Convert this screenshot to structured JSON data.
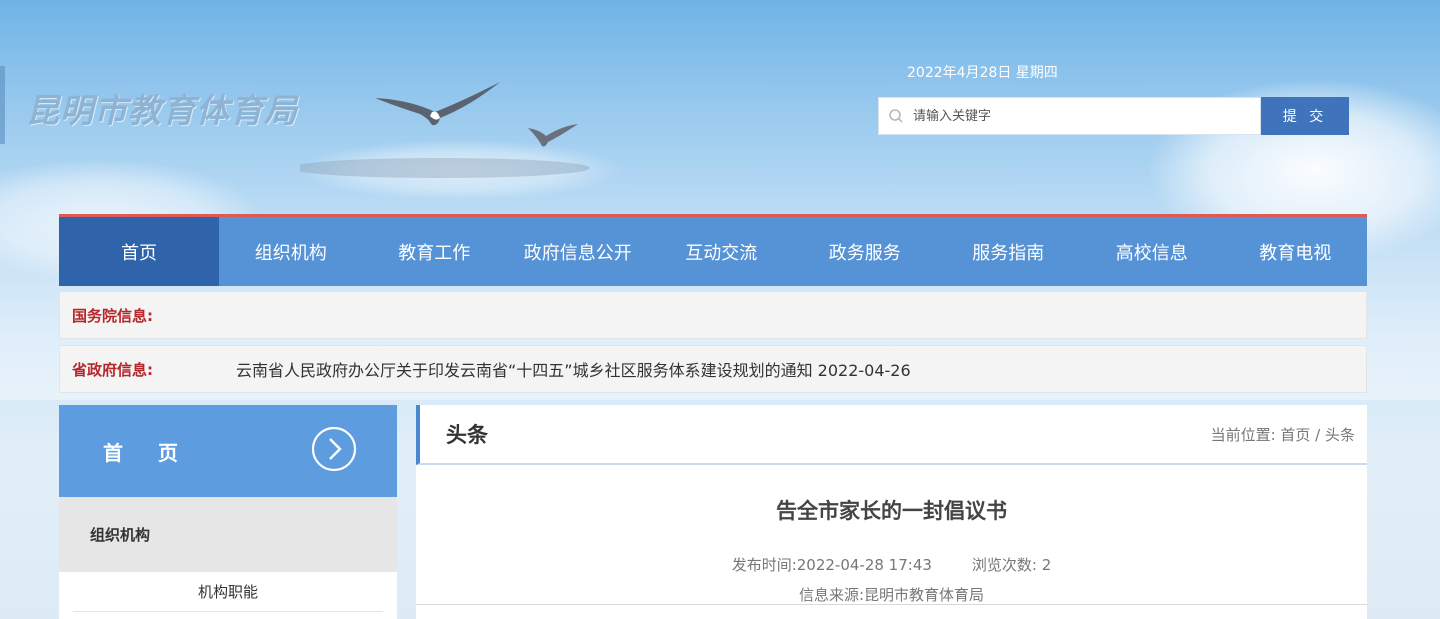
{
  "header": {
    "site_title": "昆明市教育体育局",
    "date": "2022年4月28日 星期四",
    "search": {
      "placeholder": "请输入关键字",
      "value": ""
    },
    "submit_label": "提 交"
  },
  "nav": {
    "items": [
      {
        "label": "首页"
      },
      {
        "label": "组织机构"
      },
      {
        "label": "教育工作"
      },
      {
        "label": "政府信息公开"
      },
      {
        "label": "互动交流"
      },
      {
        "label": "政务服务"
      },
      {
        "label": "服务指南"
      },
      {
        "label": "高校信息"
      },
      {
        "label": "教育电视"
      }
    ]
  },
  "info": {
    "state_council_label": "国务院信息:",
    "state_council_text": "",
    "province_label": "省政府信息:",
    "province_text": "云南省人民政府办公厅关于印发云南省“十四五”城乡社区服务体系建设规划的通知 2022-04-26"
  },
  "sidebar": {
    "title": "首 页",
    "category": "组织机构",
    "sub_item": "机构职能"
  },
  "content": {
    "section_title": "头条",
    "breadcrumb": "当前位置:  首页 / 头条",
    "article_title": "告全市家长的一封倡议书",
    "publish_time": "发布时间:2022-04-28 17:43",
    "views": "浏览次数:  2",
    "source": "信息来源:昆明市教育体育局"
  },
  "colors": {
    "nav_bg": "#5592d6",
    "nav_active": "#2f64ab",
    "label_red": "#b5272a",
    "sidebar_head": "#5d9cdf",
    "submit_bg": "#3f74bd"
  },
  "icons": [
    "search-icon",
    "chevron-right-circle-icon",
    "seagull-icon"
  ]
}
